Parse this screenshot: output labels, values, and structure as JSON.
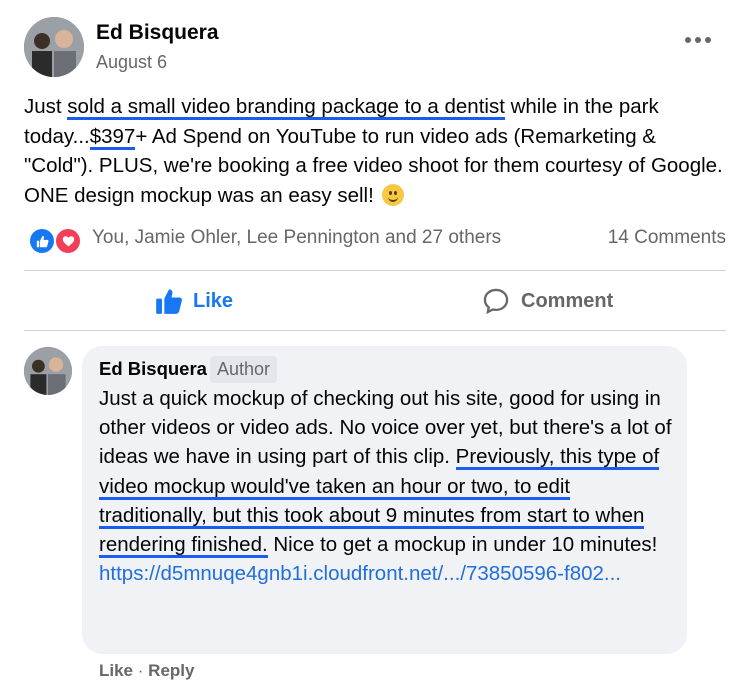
{
  "post": {
    "author": "Ed Bisquera",
    "date": "August 6",
    "more_icon": "more-horizontal-icon",
    "text": {
      "p1": "Just ",
      "u1": "sold a small video branding package to a dentist",
      "p2": " while in the park today...",
      "u2": "$397",
      "p3": "+ Ad Spend on YouTube to run video ads (Remarketing & \"Cold\"). PLUS, we're booking a free video shoot for them courtesy of Google. ONE design mockup was an easy sell! ",
      "emoji": "slightly-smiling-face-emoji"
    },
    "reactions": {
      "icons": [
        "like-reaction-icon",
        "love-reaction-icon"
      ],
      "names": "You, Jamie Ohler, Lee Pennington and 27 others",
      "comment_count": "14 Comments"
    },
    "actions": {
      "like_label": "Like",
      "comment_label": "Comment"
    }
  },
  "comment": {
    "author": "Ed Bisquera",
    "badge": "Author",
    "text": {
      "p1": "Just a quick mockup of checking out his site, good for using in other videos or video ads. No voice over yet, but there's a lot of ideas we have in using part of this clip. ",
      "u1": "Previously, this type of video mockup would've taken an hour or two, to edit traditionally, but this took about 9 minutes from start to when rendering finished.",
      "p2": " Nice to get a mockup in under 10 minutes! ",
      "link": "https://d5mnuqe4gnb1i.cloudfront.net/.../73850596-f802..."
    },
    "actions": {
      "like": "Like",
      "separator": "·",
      "reply": "Reply"
    }
  },
  "colors": {
    "link": "#216fdb",
    "like_blue": "#1877f2",
    "love_red": "#f33e58",
    "underline_annotation": "#1a5cf0",
    "bubble_bg": "#f0f2f5"
  }
}
